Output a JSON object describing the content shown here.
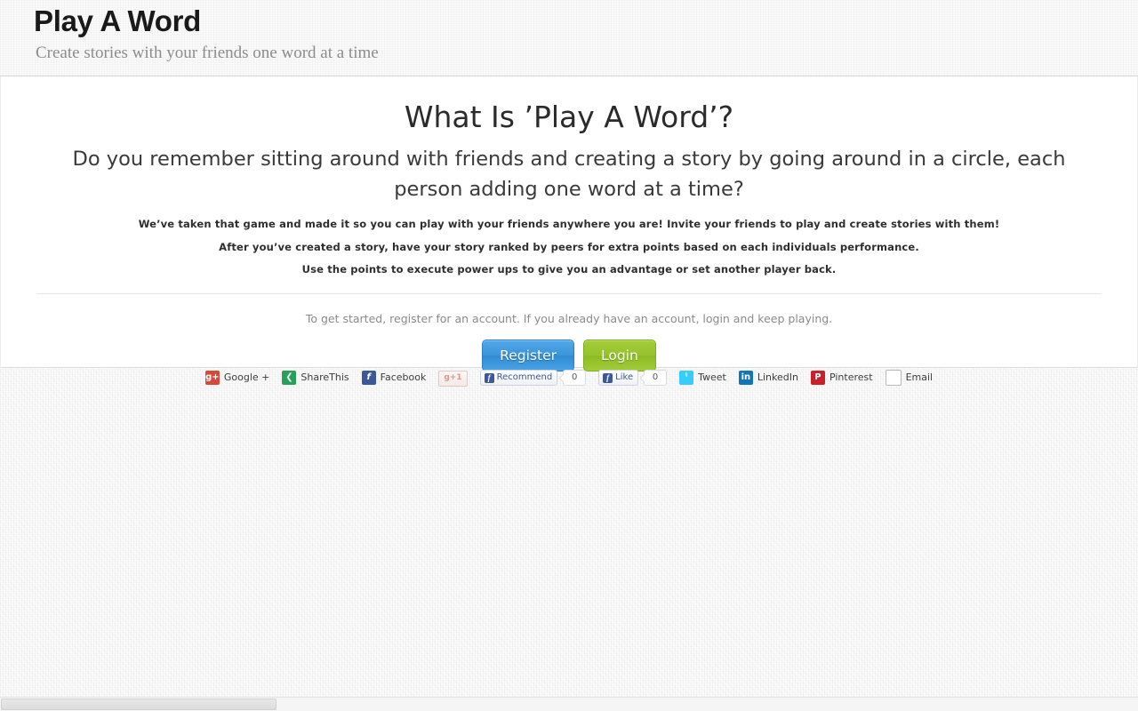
{
  "header": {
    "title": "Play A Word",
    "tagline": "Create stories with your friends one word at a time"
  },
  "main": {
    "heading": "What Is ’Play A Word’?",
    "lede": "Do you remember sitting around with friends and creating a story by going around in a circle, each person adding one word at a time?",
    "features": [
      "We’ve taken that game and made it so you can play with your friends anywhere you are! Invite your friends to play and create stories with them!",
      "After you’ve created a story, have your story ranked by peers for extra points based on each individuals performance.",
      "Use the points to execute power ups to give you an advantage or set another player back."
    ],
    "cta_text": "To get started, register for an account. If you already have an account, login and keep playing.",
    "register_label": "Register",
    "login_label": "Login"
  },
  "share_bar": {
    "google_plus": {
      "label": "Google +",
      "icon": "google-plus-icon",
      "glyph": "g+"
    },
    "sharethis": {
      "label": "ShareThis",
      "icon": "sharethis-icon",
      "glyph": "❮"
    },
    "facebook": {
      "label": "Facebook",
      "icon": "facebook-icon",
      "glyph": "f"
    },
    "gplus_one": {
      "label": "g+1"
    },
    "recommend": {
      "label": "Recommend",
      "glyph": "f",
      "count": "0"
    },
    "like": {
      "label": "Like",
      "glyph": "f",
      "count": "0"
    },
    "tweet": {
      "label": "Tweet",
      "icon": "twitter-icon",
      "glyph": "ᵗ"
    },
    "linkedin": {
      "label": "LinkedIn",
      "icon": "linkedin-icon",
      "glyph": "in"
    },
    "pinterest": {
      "label": "Pinterest",
      "icon": "pinterest-icon",
      "glyph": "P"
    },
    "email": {
      "label": "Email",
      "icon": "email-icon",
      "glyph": "✉"
    }
  },
  "colors": {
    "register_button": "#3b95d9",
    "login_button": "#96c22c",
    "page_background": "#f1f1f1",
    "panel_background": "#ffffff",
    "tagline_text": "#8c8c8c"
  }
}
